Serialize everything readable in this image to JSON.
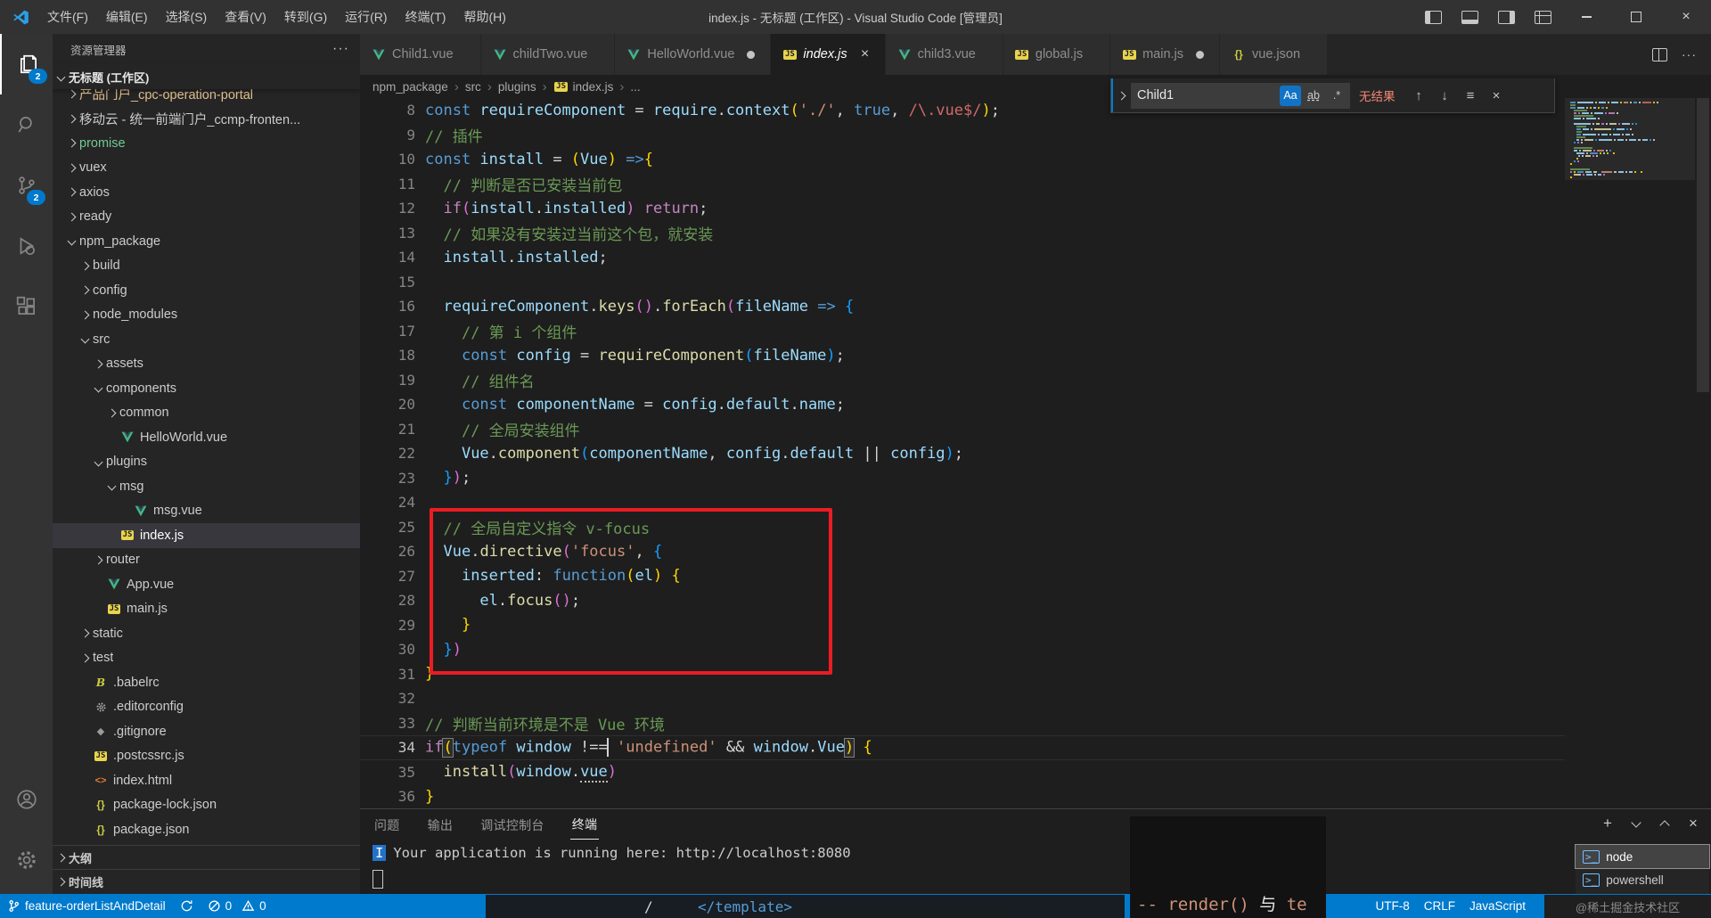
{
  "title_bar": {
    "menus": [
      "文件(F)",
      "编辑(E)",
      "选择(S)",
      "查看(V)",
      "转到(G)",
      "运行(R)",
      "终端(T)",
      "帮助(H)"
    ],
    "title": "index.js - 无标题 (工作区) - Visual Studio Code [管理员]"
  },
  "activity": {
    "explorer_badge": "2",
    "scm_badge": "2"
  },
  "sidebar": {
    "header": "资源管理器",
    "section": "无标题 (工作区)",
    "outline": "大纲",
    "timeline": "时间线",
    "tree": [
      {
        "label": "产品门户_cpc-operation-portal",
        "lvl": 0,
        "chev": "right",
        "color": "mod"
      },
      {
        "label": "移动云 - 统一前端门户_ccmp-fronten...",
        "lvl": 0,
        "chev": "right"
      },
      {
        "label": "promise",
        "lvl": 0,
        "chev": "right",
        "color": "green"
      },
      {
        "label": "vuex",
        "lvl": 0,
        "chev": "right"
      },
      {
        "label": "axios",
        "lvl": 0,
        "chev": "right"
      },
      {
        "label": "ready",
        "lvl": 0,
        "chev": "right"
      },
      {
        "label": "npm_package",
        "lvl": 0,
        "chev": "down"
      },
      {
        "label": "build",
        "lvl": 1,
        "chev": "right"
      },
      {
        "label": "config",
        "lvl": 1,
        "chev": "right"
      },
      {
        "label": "node_modules",
        "lvl": 1,
        "chev": "right"
      },
      {
        "label": "src",
        "lvl": 1,
        "chev": "down"
      },
      {
        "label": "assets",
        "lvl": 2,
        "chev": "right"
      },
      {
        "label": "components",
        "lvl": 2,
        "chev": "down"
      },
      {
        "label": "common",
        "lvl": 3,
        "chev": "right"
      },
      {
        "label": "HelloWorld.vue",
        "lvl": 3,
        "icon": "vue"
      },
      {
        "label": "plugins",
        "lvl": 2,
        "chev": "down"
      },
      {
        "label": "msg",
        "lvl": 3,
        "chev": "down"
      },
      {
        "label": "msg.vue",
        "lvl": 4,
        "icon": "vue"
      },
      {
        "label": "index.js",
        "lvl": 3,
        "icon": "js",
        "selected": true
      },
      {
        "label": "router",
        "lvl": 2,
        "chev": "right"
      },
      {
        "label": "App.vue",
        "lvl": 2,
        "icon": "vue"
      },
      {
        "label": "main.js",
        "lvl": 2,
        "icon": "js"
      },
      {
        "label": "static",
        "lvl": 1,
        "chev": "right"
      },
      {
        "label": "test",
        "lvl": 1,
        "chev": "right"
      },
      {
        "label": ".babelrc",
        "lvl": 1,
        "icon": "babel"
      },
      {
        "label": ".editorconfig",
        "lvl": 1,
        "icon": "gear"
      },
      {
        "label": ".gitignore",
        "lvl": 1,
        "icon": "git"
      },
      {
        "label": ".postcssrc.js",
        "lvl": 1,
        "icon": "js"
      },
      {
        "label": "index.html",
        "lvl": 1,
        "icon": "html"
      },
      {
        "label": "package-lock.json",
        "lvl": 1,
        "icon": "json"
      },
      {
        "label": "package.json",
        "lvl": 1,
        "icon": "json"
      }
    ]
  },
  "tabs": [
    {
      "label": "Child1.vue",
      "icon": "vue"
    },
    {
      "label": "childTwo.vue",
      "icon": "vue"
    },
    {
      "label": "HelloWorld.vue",
      "icon": "vue",
      "dirty": true
    },
    {
      "label": "index.js",
      "icon": "js",
      "active": true,
      "italic": true,
      "close": true
    },
    {
      "label": "child3.vue",
      "icon": "vue"
    },
    {
      "label": "global.js",
      "icon": "js"
    },
    {
      "label": "main.js",
      "icon": "js",
      "dirty": true
    },
    {
      "label": "vue.json",
      "icon": "json"
    }
  ],
  "breadcrumb": {
    "items": [
      "npm_package",
      "src",
      "plugins",
      "index.js",
      "..."
    ]
  },
  "find": {
    "query": "Child1",
    "case_icon": "Aa",
    "word_icon": "ab",
    "regex_icon": ".*",
    "results": "无结果"
  },
  "editor": {
    "lines": [
      {
        "n": 8,
        "segs": [
          {
            "t": "const ",
            "c": "k"
          },
          {
            "t": "requireComponent",
            "c": "v"
          },
          {
            "t": " = ",
            "c": "w"
          },
          {
            "t": "require",
            "c": "v"
          },
          {
            "t": ".",
            "c": "w"
          },
          {
            "t": "context",
            "c": "v"
          },
          {
            "t": "(",
            "c": "y"
          },
          {
            "t": "'./'",
            "c": "s"
          },
          {
            "t": ", ",
            "c": "w"
          },
          {
            "t": "true",
            "c": "k"
          },
          {
            "t": ", ",
            "c": "w"
          },
          {
            "t": "/\\.vue$/",
            "c": "re"
          },
          {
            "t": ")",
            "c": "y"
          },
          {
            "t": ";",
            "c": "w"
          }
        ]
      },
      {
        "n": 9,
        "segs": [
          {
            "t": "// 插件",
            "c": "c"
          }
        ]
      },
      {
        "n": 10,
        "segs": [
          {
            "t": "const ",
            "c": "k"
          },
          {
            "t": "install",
            "c": "v"
          },
          {
            "t": " = ",
            "c": "w"
          },
          {
            "t": "(",
            "c": "y"
          },
          {
            "t": "Vue",
            "c": "v"
          },
          {
            "t": ")",
            "c": "y"
          },
          {
            "t": " =>",
            "c": "k"
          },
          {
            "t": "{",
            "c": "y"
          }
        ]
      },
      {
        "n": 11,
        "segs": [
          {
            "t": "  ",
            "c": "w"
          },
          {
            "t": "// 判断是否已安装当前包",
            "c": "c"
          }
        ]
      },
      {
        "n": 12,
        "segs": [
          {
            "t": "  ",
            "c": "w"
          },
          {
            "t": "if",
            "c": "kc"
          },
          {
            "t": "(",
            "c": "m"
          },
          {
            "t": "install",
            "c": "v"
          },
          {
            "t": ".",
            "c": "w"
          },
          {
            "t": "installed",
            "c": "v"
          },
          {
            "t": ")",
            "c": "m"
          },
          {
            "t": " return",
            "c": "kc"
          },
          {
            "t": ";",
            "c": "w"
          }
        ]
      },
      {
        "n": 13,
        "segs": [
          {
            "t": "  ",
            "c": "w"
          },
          {
            "t": "// 如果没有安装过当前这个包，就安装",
            "c": "c"
          }
        ]
      },
      {
        "n": 14,
        "segs": [
          {
            "t": "  ",
            "c": "w"
          },
          {
            "t": "install",
            "c": "v"
          },
          {
            "t": ".",
            "c": "w"
          },
          {
            "t": "installed",
            "c": "v"
          },
          {
            "t": ";",
            "c": "w"
          }
        ]
      },
      {
        "n": 15,
        "segs": []
      },
      {
        "n": 16,
        "segs": [
          {
            "t": "  ",
            "c": "w"
          },
          {
            "t": "requireComponent",
            "c": "v"
          },
          {
            "t": ".",
            "c": "w"
          },
          {
            "t": "keys",
            "c": "f"
          },
          {
            "t": "()",
            "c": "m"
          },
          {
            "t": ".",
            "c": "w"
          },
          {
            "t": "forEach",
            "c": "f"
          },
          {
            "t": "(",
            "c": "m"
          },
          {
            "t": "fileName",
            "c": "v"
          },
          {
            "t": " => ",
            "c": "k"
          },
          {
            "t": "{",
            "c": "b"
          }
        ]
      },
      {
        "n": 17,
        "segs": [
          {
            "t": "    ",
            "c": "w"
          },
          {
            "t": "// 第 i 个组件",
            "c": "c"
          }
        ]
      },
      {
        "n": 18,
        "segs": [
          {
            "t": "    ",
            "c": "w"
          },
          {
            "t": "const ",
            "c": "k"
          },
          {
            "t": "config",
            "c": "v"
          },
          {
            "t": " = ",
            "c": "w"
          },
          {
            "t": "requireComponent",
            "c": "f"
          },
          {
            "t": "(",
            "c": "b"
          },
          {
            "t": "fileName",
            "c": "v"
          },
          {
            "t": ")",
            "c": "b"
          },
          {
            "t": ";",
            "c": "w"
          }
        ]
      },
      {
        "n": 19,
        "segs": [
          {
            "t": "    ",
            "c": "w"
          },
          {
            "t": "// 组件名",
            "c": "c"
          }
        ]
      },
      {
        "n": 20,
        "segs": [
          {
            "t": "    ",
            "c": "w"
          },
          {
            "t": "const ",
            "c": "k"
          },
          {
            "t": "componentName",
            "c": "v"
          },
          {
            "t": " = ",
            "c": "w"
          },
          {
            "t": "config",
            "c": "v"
          },
          {
            "t": ".",
            "c": "w"
          },
          {
            "t": "default",
            "c": "v"
          },
          {
            "t": ".",
            "c": "w"
          },
          {
            "t": "name",
            "c": "v"
          },
          {
            "t": ";",
            "c": "w"
          }
        ]
      },
      {
        "n": 21,
        "segs": [
          {
            "t": "    ",
            "c": "w"
          },
          {
            "t": "// 全局安装组件",
            "c": "c"
          }
        ]
      },
      {
        "n": 22,
        "segs": [
          {
            "t": "    ",
            "c": "w"
          },
          {
            "t": "Vue",
            "c": "v"
          },
          {
            "t": ".",
            "c": "w"
          },
          {
            "t": "component",
            "c": "f"
          },
          {
            "t": "(",
            "c": "b"
          },
          {
            "t": "componentName",
            "c": "v"
          },
          {
            "t": ", ",
            "c": "w"
          },
          {
            "t": "config",
            "c": "v"
          },
          {
            "t": ".",
            "c": "w"
          },
          {
            "t": "default",
            "c": "v"
          },
          {
            "t": " || ",
            "c": "w"
          },
          {
            "t": "config",
            "c": "v"
          },
          {
            "t": ")",
            "c": "b"
          },
          {
            "t": ";",
            "c": "w"
          }
        ]
      },
      {
        "n": 23,
        "segs": [
          {
            "t": "  ",
            "c": "w"
          },
          {
            "t": "}",
            "c": "b"
          },
          {
            "t": ")",
            "c": "m"
          },
          {
            "t": ";",
            "c": "w"
          }
        ]
      },
      {
        "n": 24,
        "segs": []
      },
      {
        "n": 25,
        "segs": [
          {
            "t": "  ",
            "c": "w"
          },
          {
            "t": "// 全局自定义指令 v-focus",
            "c": "c"
          }
        ]
      },
      {
        "n": 26,
        "segs": [
          {
            "t": "  ",
            "c": "w"
          },
          {
            "t": "Vue",
            "c": "v"
          },
          {
            "t": ".",
            "c": "w"
          },
          {
            "t": "directive",
            "c": "f"
          },
          {
            "t": "(",
            "c": "m"
          },
          {
            "t": "'focus'",
            "c": "s"
          },
          {
            "t": ", ",
            "c": "w"
          },
          {
            "t": "{",
            "c": "b"
          }
        ]
      },
      {
        "n": 27,
        "segs": [
          {
            "t": "    ",
            "c": "w"
          },
          {
            "t": "inserted",
            "c": "v"
          },
          {
            "t": ": ",
            "c": "w"
          },
          {
            "t": "function",
            "c": "k"
          },
          {
            "t": "(",
            "c": "y"
          },
          {
            "t": "el",
            "c": "v"
          },
          {
            "t": ")",
            "c": "y"
          },
          {
            "t": " ",
            "c": "w"
          },
          {
            "t": "{",
            "c": "y"
          }
        ]
      },
      {
        "n": 28,
        "segs": [
          {
            "t": "      ",
            "c": "w"
          },
          {
            "t": "el",
            "c": "v"
          },
          {
            "t": ".",
            "c": "w"
          },
          {
            "t": "focus",
            "c": "f"
          },
          {
            "t": "()",
            "c": "m"
          },
          {
            "t": ";",
            "c": "w"
          }
        ]
      },
      {
        "n": 29,
        "segs": [
          {
            "t": "    ",
            "c": "w"
          },
          {
            "t": "}",
            "c": "y"
          }
        ]
      },
      {
        "n": 30,
        "segs": [
          {
            "t": "  ",
            "c": "w"
          },
          {
            "t": "}",
            "c": "b"
          },
          {
            "t": ")",
            "c": "m"
          }
        ]
      },
      {
        "n": 31,
        "segs": [
          {
            "t": "}",
            "c": "y"
          }
        ]
      },
      {
        "n": 32,
        "segs": []
      },
      {
        "n": 33,
        "segs": [
          {
            "t": "// 判断当前环境是不是 Vue 环境",
            "c": "c"
          }
        ]
      },
      {
        "n": 34,
        "cur": true,
        "segs": [
          {
            "t": "if",
            "c": "kc"
          },
          {
            "t": "(",
            "c": "y",
            "bm": 1
          },
          {
            "t": "typeof ",
            "c": "k"
          },
          {
            "t": "window",
            "c": "v"
          },
          {
            "t": " !==",
            "c": "w"
          },
          {
            "cursor": 1
          },
          {
            "t": " ",
            "c": "w"
          },
          {
            "t": "'undefined'",
            "c": "s"
          },
          {
            "t": " && ",
            "c": "w"
          },
          {
            "t": "window",
            "c": "v"
          },
          {
            "t": ".",
            "c": "w"
          },
          {
            "t": "Vue",
            "c": "v"
          },
          {
            "t": ")",
            "c": "y",
            "bm": 1
          },
          {
            "t": " ",
            "c": "w"
          },
          {
            "t": "{",
            "c": "y"
          }
        ]
      },
      {
        "n": 35,
        "segs": [
          {
            "t": "  ",
            "c": "w"
          },
          {
            "t": "install",
            "c": "f"
          },
          {
            "t": "(",
            "c": "m"
          },
          {
            "t": "window",
            "c": "v"
          },
          {
            "t": ".",
            "c": "w"
          },
          {
            "t": "vue",
            "c": "v",
            "vd": 1
          },
          {
            "t": ")",
            "c": "m"
          }
        ]
      },
      {
        "n": 36,
        "segs": [
          {
            "t": "}",
            "c": "y"
          }
        ]
      }
    ]
  },
  "panel": {
    "tabs": [
      "问题",
      "输出",
      "调试控制台",
      "终端"
    ],
    "active_tab": "终端",
    "terminal_badge": "I",
    "terminal_text": "Your application is running here: http://localhost:8080",
    "instances": [
      "node",
      "powershell"
    ]
  },
  "status": {
    "branch": "feature-orderListAndDetail",
    "errors": "0",
    "warnings": "0",
    "right_items": [
      "UTF-8",
      "CRLF",
      "JavaScript"
    ]
  },
  "overlays": {
    "slash": "/",
    "template_tag": "</template>",
    "render_a": "-- render() ",
    "render_b": "与",
    "render_c": " te",
    "watermark": "@稀土掘金技术社区"
  }
}
